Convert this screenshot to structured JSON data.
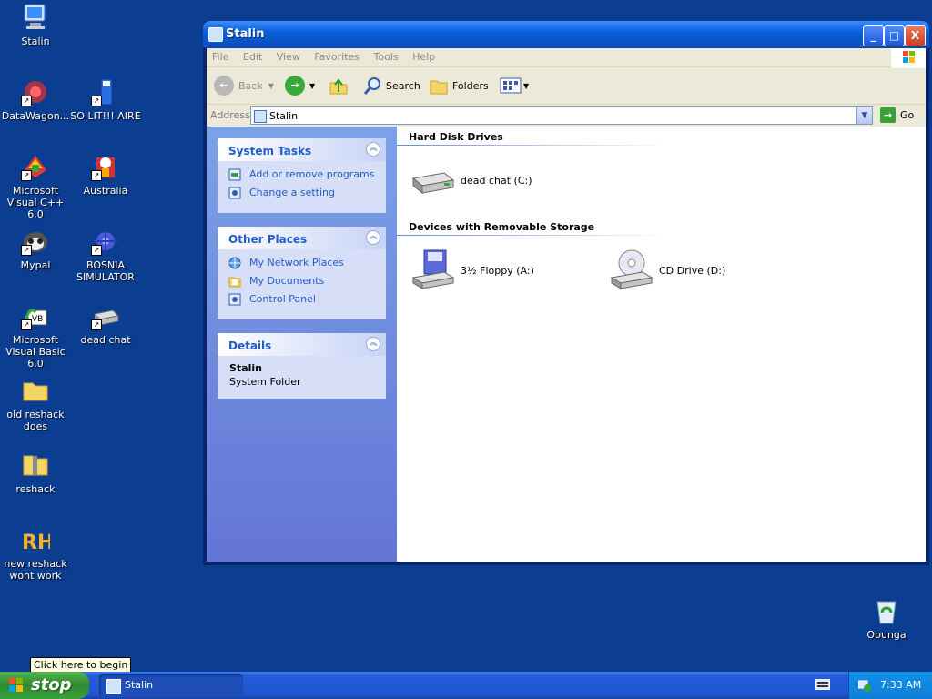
{
  "desktop": {
    "icons": [
      {
        "label": "Stalin"
      },
      {
        "label": "DataWagon..."
      },
      {
        "label": "SO LIT!!! AIRE"
      },
      {
        "label": "Microsoft Visual C++ 6.0"
      },
      {
        "label": "Australia"
      },
      {
        "label": "Mypal"
      },
      {
        "label": "BOSNIA SIMULATOR"
      },
      {
        "label": "Microsoft Visual Basic 6.0"
      },
      {
        "label": "dead chat"
      },
      {
        "label": "old reshack does"
      },
      {
        "label": "reshack"
      },
      {
        "label": "new reshack wont work"
      },
      {
        "label": "Obunga"
      }
    ]
  },
  "window": {
    "title": "Stalin",
    "controls": {
      "minimize": "_",
      "maximize": "□",
      "close": "X"
    },
    "menu": [
      "File",
      "Edit",
      "View",
      "Favorites",
      "Tools",
      "Help"
    ],
    "toolbar": {
      "back": "Back",
      "search": "Search",
      "folders": "Folders"
    },
    "address": {
      "label": "Address",
      "value": "Stalin",
      "go": "Go"
    },
    "panels": {
      "system_tasks": {
        "title": "System Tasks",
        "items": [
          "Add or remove programs",
          "Change a setting"
        ]
      },
      "other_places": {
        "title": "Other Places",
        "items": [
          "My Network Places",
          "My Documents",
          "Control Panel"
        ]
      },
      "details": {
        "title": "Details",
        "name": "Stalin",
        "type": "System Folder"
      }
    },
    "groups": {
      "hdd": {
        "title": "Hard Disk Drives",
        "drives": [
          {
            "label": "dead chat (C:)"
          }
        ]
      },
      "removable": {
        "title": "Devices with Removable Storage",
        "drives": [
          {
            "label": "3½ Floppy (A:)"
          },
          {
            "label": "CD Drive (D:)"
          }
        ]
      }
    }
  },
  "taskbar": {
    "start_label": "stop",
    "tooltip": "Click here to begin",
    "task": "Stalin",
    "clock": "7:33 AM"
  }
}
